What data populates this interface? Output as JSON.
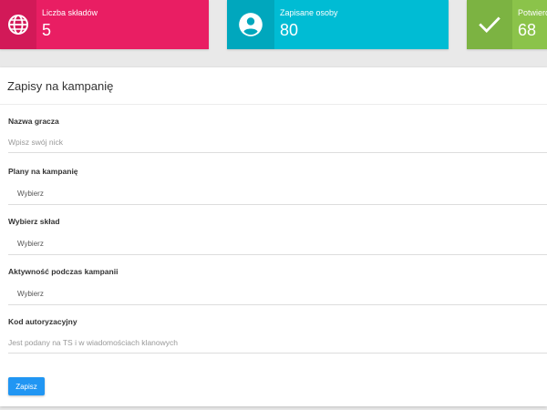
{
  "stats": {
    "squads": {
      "label": "Liczba składów",
      "value": "5",
      "color": "#e91e63",
      "icon": "globe-icon"
    },
    "enrolled": {
      "label": "Zapisane osoby",
      "value": "80",
      "color": "#00bcd4",
      "icon": "account-circle-icon"
    },
    "confirmed": {
      "label": "Potwierd",
      "value": "68",
      "color": "#8bc34a",
      "icon": "check-icon"
    }
  },
  "form": {
    "title": "Zapisy na kampanię",
    "fields": {
      "nick": {
        "label": "Nazwa gracza",
        "placeholder": "Wpisz swój nick"
      },
      "plans": {
        "label": "Plany na kampanię",
        "value": "Wybierz"
      },
      "squad": {
        "label": "Wybierz skład",
        "value": "Wybierz"
      },
      "activity": {
        "label": "Aktywność podczas kampanii",
        "value": "Wybierz"
      },
      "code": {
        "label": "Kod autoryzacyjny",
        "placeholder": "Jest podany na TS i w wiadomościach klanowych"
      }
    },
    "save_label": "Zapisz"
  }
}
